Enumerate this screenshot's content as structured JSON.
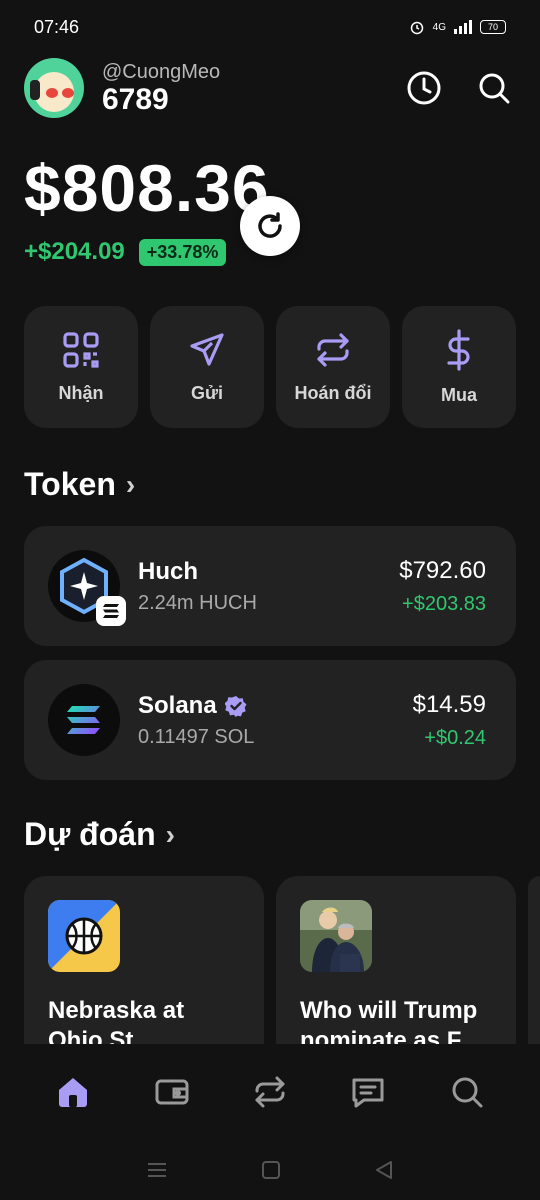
{
  "status_bar": {
    "time": "07:46",
    "network": "4G",
    "battery": "70"
  },
  "header": {
    "username": "@CuongMeo",
    "user_number": "6789"
  },
  "balance": {
    "total": "$808.36",
    "change_amount": "+$204.09",
    "change_percent": "+33.78%"
  },
  "actions": [
    {
      "label": "Nhận",
      "icon": "qr-code-icon"
    },
    {
      "label": "Gửi",
      "icon": "send-icon"
    },
    {
      "label": "Hoán đổi",
      "icon": "swap-icon"
    },
    {
      "label": "Mua",
      "icon": "dollar-icon"
    }
  ],
  "token_section": {
    "title": "Token"
  },
  "tokens": [
    {
      "name": "Huch",
      "amount": "2.24m HUCH",
      "price": "$792.60",
      "change": "+$203.83"
    },
    {
      "name": "Solana",
      "amount": "0.11497 SOL",
      "price": "$14.59",
      "change": "+$0.24"
    }
  ],
  "prediction_section": {
    "title": "Dự đoán"
  },
  "predictions": [
    {
      "title_line1": "Nebraska at",
      "title_line2": "Ohio St"
    },
    {
      "title_line1": "Who will Trump",
      "title_line2": "nominate as F"
    }
  ],
  "colors": {
    "accent": "#a99cf4",
    "positive": "#2fc76f",
    "card": "#222222",
    "background": "#121212"
  }
}
